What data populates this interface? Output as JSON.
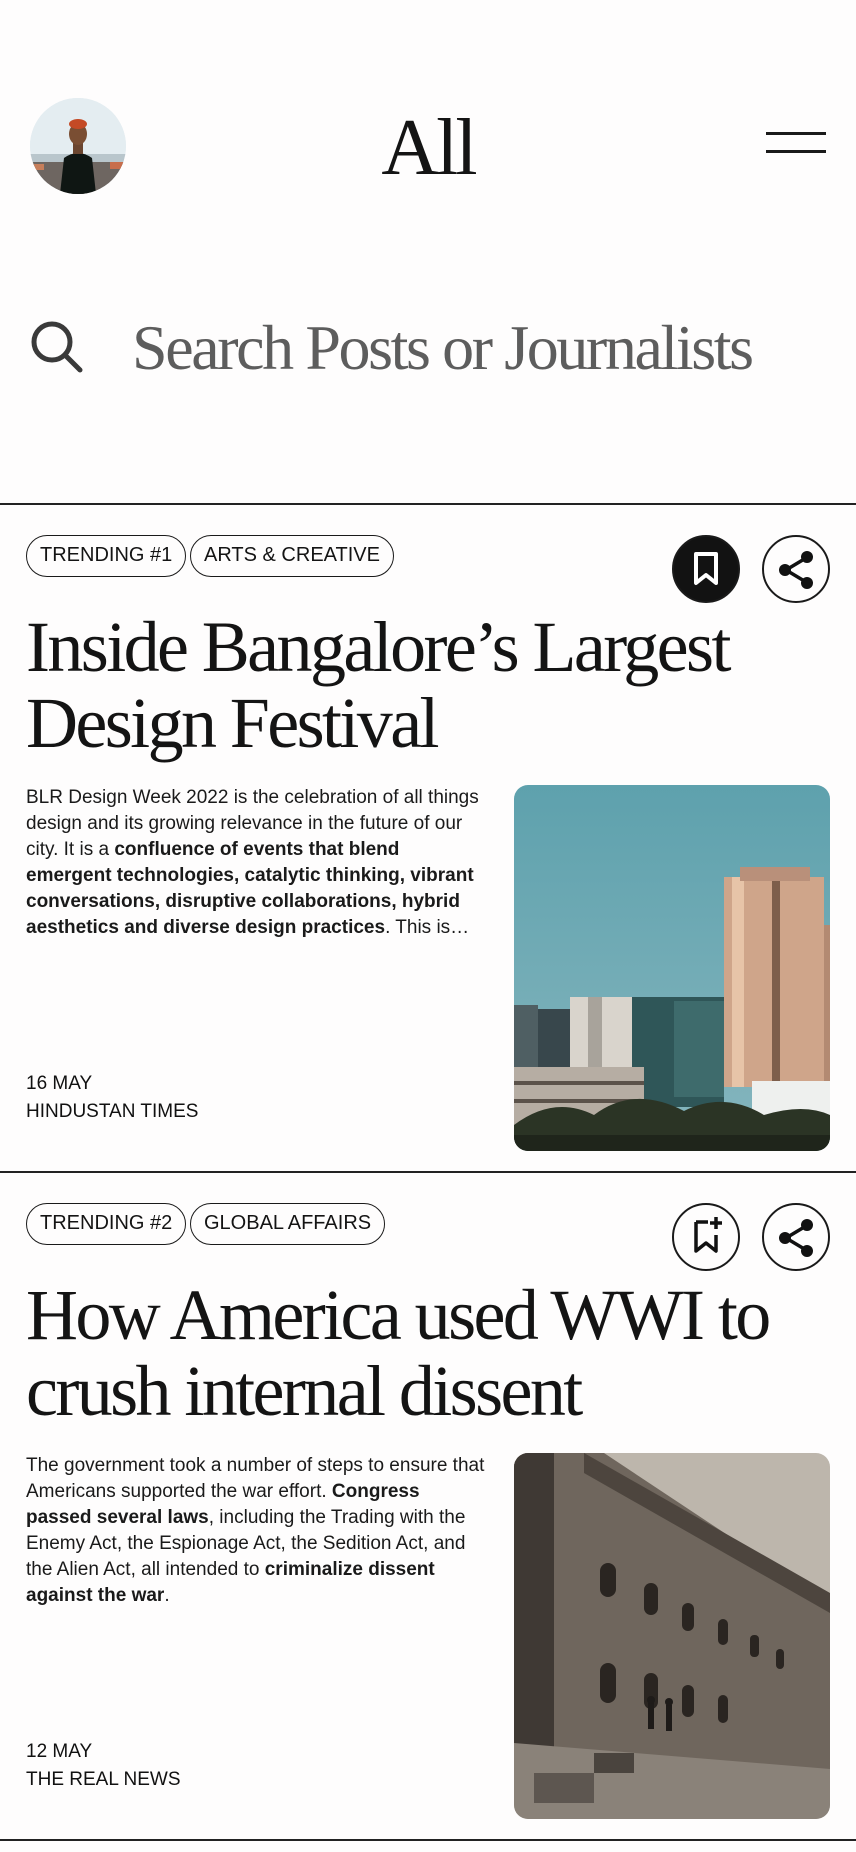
{
  "header": {
    "title": "All",
    "avatar_icon": "user-avatar",
    "menu_icon": "hamburger-menu-icon"
  },
  "search": {
    "placeholder": "Search Posts or Journalists",
    "icon": "search-icon"
  },
  "articles": [
    {
      "tags": [
        "TRENDING #1",
        "ARTS & CREATIVE"
      ],
      "bookmarked": true,
      "title_line1": "Inside Bangalore’s Largest",
      "title_line2": "Design Festival",
      "body": [
        {
          "text": "BLR Design Week 2022 is the celebration of all things design and its growing relevance in the future of our city. It is a ",
          "bold": false
        },
        {
          "text": "confluence of events that blend emergent technologies, catalytic thinking, vibrant conversations, disruptive collaborations, hybrid aesthetics and diverse design practices",
          "bold": true
        },
        {
          "text": ". This is…",
          "bold": false
        }
      ],
      "date": "16 MAY",
      "source": "HINDUSTAN TIMES",
      "image": "city-skyline-photo"
    },
    {
      "tags": [
        "TRENDING #2",
        "GLOBAL AFFAIRS"
      ],
      "bookmarked": false,
      "title_line1": "How America used WWI to",
      "title_line2": "crush internal dissent",
      "body": [
        {
          "text": "The government took a number of steps to ensure that Americans supported the war effort. ",
          "bold": false
        },
        {
          "text": "Congress passed several laws",
          "bold": true
        },
        {
          "text": ", including the Trading with the Enemy Act, the Espionage Act, the Sedition Act, and the Alien Act, all intended to ",
          "bold": false
        },
        {
          "text": "criminalize dissent against the war",
          "bold": true
        },
        {
          "text": ".",
          "bold": false
        }
      ],
      "date": "12 MAY",
      "source": "THE REAL NEWS",
      "image": "old-fortress-wall-photo"
    }
  ]
}
